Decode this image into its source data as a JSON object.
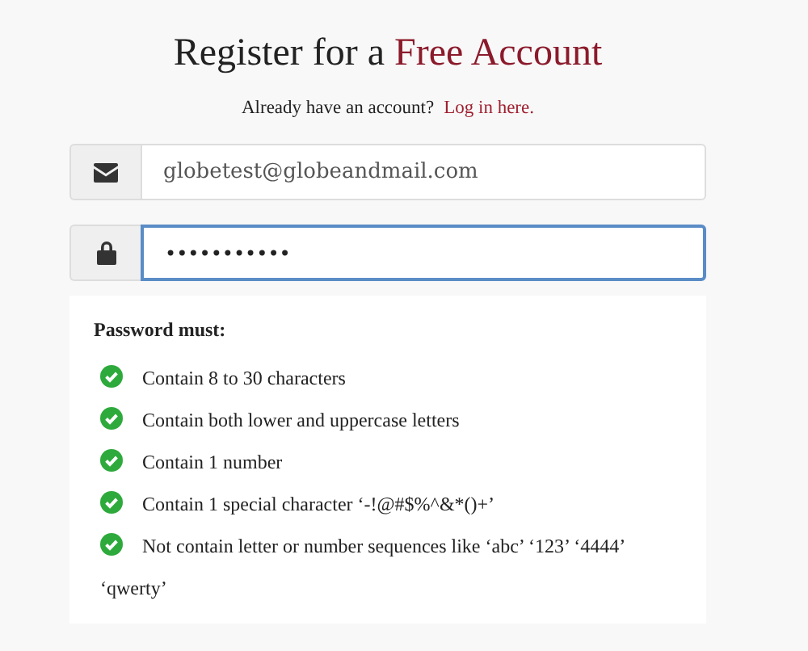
{
  "heading": {
    "text": "Register for a",
    "accent": "Free Account"
  },
  "login_prompt": {
    "text": "Already have an account?",
    "link": "Log in here."
  },
  "fields": [
    {
      "kind": "email",
      "value": "globetest@globeandmail.com",
      "focused": false
    },
    {
      "kind": "password",
      "value": "•••••••••••",
      "focused": true
    }
  ],
  "password_rules": {
    "title": "Password must:",
    "items": [
      {
        "text": "Contain 8 to 30 characters",
        "met": true
      },
      {
        "text": "Contain both lower and uppercase letters",
        "met": true
      },
      {
        "text": "Contain 1 number",
        "met": true
      },
      {
        "text": "Contain 1 special character ‘-!@#$%^&*()+’",
        "met": true
      },
      {
        "text": "Not contain letter or number sequences like ‘abc’ ‘123’ ‘4444’ ‘qwerty’",
        "met": true
      }
    ]
  }
}
